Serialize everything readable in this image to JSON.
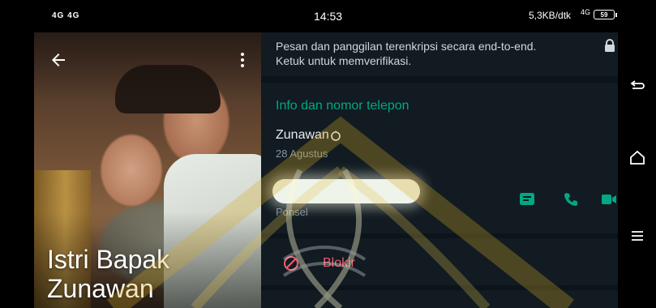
{
  "status_bar": {
    "signal": "4G 4G",
    "time": "14:53",
    "net_speed": "5,3KB/dtk",
    "net_type": "4G",
    "battery": "59"
  },
  "photo": {
    "contact_name": "Istri Bapak Zunawan",
    "back_icon": "arrow-left-icon",
    "menu_icon": "more-vertical-icon"
  },
  "encryption": {
    "text": "Pesan dan panggilan terenkripsi secara end-to-end. Ketuk untuk memverifikasi.",
    "icon": "lock-icon"
  },
  "info": {
    "title": "Info dan nomor telepon",
    "about": "Zunawan",
    "about_icon": "ring-icon",
    "about_date": "28 Agustus",
    "phone_label": "Ponsel",
    "actions": [
      "message-icon",
      "phone-icon",
      "video-icon"
    ]
  },
  "block": {
    "label": "Blokir",
    "icon": "block-icon"
  },
  "nav": [
    "back-icon",
    "home-icon",
    "recents-icon"
  ],
  "colors": {
    "accent": "#00a884",
    "danger": "#f15c6d",
    "panel": "#111b21",
    "background": "#0b141a"
  }
}
